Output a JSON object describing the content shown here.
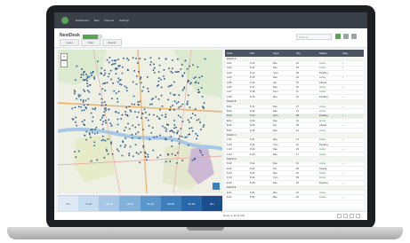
{
  "app": {
    "name": "NestDesk",
    "menu": [
      "Dashboard",
      "Map",
      "Reports",
      "Settings"
    ],
    "progress": 0.78
  },
  "toolbar": {
    "buttons": [
      "Layer",
      "Filter",
      "Export"
    ],
    "search_placeholder": "Search..."
  },
  "table": {
    "headers": [
      "Area",
      "Plot",
      "Type",
      "Qty",
      "Status",
      "Flag"
    ],
    "rows": [
      {
        "kind": "group",
        "cells": [
          "District A",
          "",
          "",
          "",
          "",
          ""
        ]
      },
      {
        "kind": "row",
        "cells": [
          "A-01",
          "P-12",
          "Res",
          "24",
          "Active",
          "•"
        ]
      },
      {
        "kind": "row",
        "cells": [
          "A-02",
          "P-13",
          "Res",
          "18",
          "Active",
          "•"
        ]
      },
      {
        "kind": "row",
        "cells": [
          "A-03",
          "P-14",
          "Com",
          "09",
          "Pending",
          ""
        ]
      },
      {
        "kind": "row",
        "cells": [
          "A-04",
          "P-15",
          "Res",
          "31",
          "Active",
          "•"
        ]
      },
      {
        "kind": "row",
        "cells": [
          "A-05",
          "P-16",
          "Ind",
          "07",
          "Closed",
          ""
        ]
      },
      {
        "kind": "row",
        "cells": [
          "A-06",
          "P-17",
          "Res",
          "22",
          "Active",
          "•"
        ]
      },
      {
        "kind": "row",
        "cells": [
          "A-07",
          "P-18",
          "Com",
          "11",
          "Active",
          ""
        ]
      },
      {
        "kind": "row",
        "cells": [
          "A-08",
          "P-19",
          "Res",
          "16",
          "Pending",
          "•"
        ]
      },
      {
        "kind": "group",
        "cells": [
          "District B",
          "",
          "",
          "",
          "",
          ""
        ]
      },
      {
        "kind": "row",
        "cells": [
          "B-01",
          "P-21",
          "Res",
          "27",
          "Active",
          "•"
        ]
      },
      {
        "kind": "row",
        "cells": [
          "B-02",
          "P-22",
          "Res",
          "14",
          "Active",
          ""
        ]
      },
      {
        "kind": "sel",
        "cells": [
          "B-03",
          "P-23",
          "Com",
          "08",
          "Pending",
          "•"
        ]
      },
      {
        "kind": "row",
        "cells": [
          "B-04",
          "P-24",
          "Res",
          "19",
          "Active",
          ""
        ]
      },
      {
        "kind": "row",
        "cells": [
          "B-05",
          "P-25",
          "Ind",
          "05",
          "Closed",
          "•"
        ]
      },
      {
        "kind": "row",
        "cells": [
          "B-06",
          "P-26",
          "Res",
          "21",
          "Active",
          ""
        ]
      },
      {
        "kind": "group",
        "cells": [
          "District C",
          "",
          "",
          "",
          "",
          ""
        ]
      },
      {
        "kind": "row",
        "cells": [
          "C-01",
          "P-31",
          "Res",
          "13",
          "Active",
          "•"
        ]
      },
      {
        "kind": "row",
        "cells": [
          "C-02",
          "P-32",
          "Com",
          "10",
          "Pending",
          ""
        ]
      },
      {
        "kind": "row",
        "cells": [
          "C-03",
          "P-33",
          "Res",
          "29",
          "Active",
          "•"
        ]
      },
      {
        "kind": "row",
        "cells": [
          "C-04",
          "P-34",
          "Res",
          "17",
          "Active",
          ""
        ]
      },
      {
        "kind": "group",
        "cells": [
          "District D",
          "",
          "",
          "",
          "",
          ""
        ]
      },
      {
        "kind": "row",
        "cells": [
          "D-01",
          "P-41",
          "Res",
          "12",
          "Active",
          "•"
        ]
      },
      {
        "kind": "row",
        "cells": [
          "D-02",
          "P-42",
          "Ind",
          "06",
          "Closed",
          ""
        ]
      },
      {
        "kind": "row",
        "cells": [
          "D-03",
          "P-43",
          "Res",
          "20",
          "Active",
          "•"
        ]
      },
      {
        "kind": "row",
        "cells": [
          "D-04",
          "P-44",
          "Com",
          "09",
          "Active",
          ""
        ]
      },
      {
        "kind": "row",
        "cells": [
          "D-05",
          "P-45",
          "Res",
          "25",
          "Pending",
          "•"
        ]
      },
      {
        "kind": "group",
        "cells": [
          "District E",
          "",
          "",
          "",
          "",
          ""
        ]
      },
      {
        "kind": "row",
        "cells": [
          "E-01",
          "P-51",
          "Res",
          "15",
          "Active",
          ""
        ]
      },
      {
        "kind": "row",
        "cells": [
          "E-02",
          "P-52",
          "Res",
          "23",
          "Active",
          "•"
        ]
      }
    ]
  },
  "legend": {
    "cells": [
      "0-5",
      "6-10",
      "11-15",
      "16-20",
      "21-25",
      "26-30",
      "31-35",
      "36+"
    ],
    "colors": [
      "#dfeaf6",
      "#c6dcf0",
      "#a6c8e6",
      "#82b1da",
      "#5c97cc",
      "#3d7fbd",
      "#2868a8",
      "#1a4f8c"
    ]
  },
  "footer": {
    "text": "Rows 1–30 of 412",
    "pages": [
      "‹",
      "1",
      "2",
      "›"
    ]
  },
  "colors": {
    "accent": "#52a84a",
    "header": "#3a4048",
    "plot": "#2d5a8c"
  }
}
